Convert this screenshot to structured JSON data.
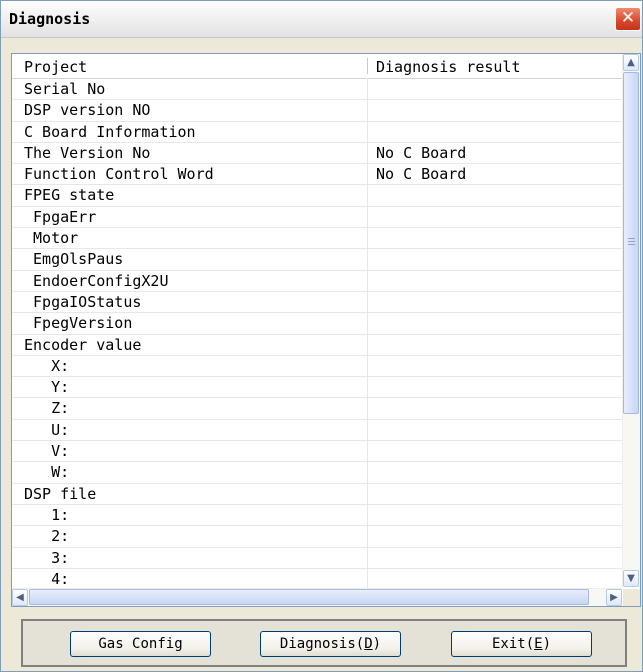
{
  "window": {
    "title": "Diagnosis",
    "close_symbol": "✕"
  },
  "table": {
    "columns": [
      "Project",
      "Diagnosis result"
    ],
    "rows": [
      {
        "project": "Serial No",
        "result": ""
      },
      {
        "project": "DSP version NO",
        "result": ""
      },
      {
        "project": "C Board Information",
        "result": ""
      },
      {
        "project": "The Version No",
        "result": "No C Board"
      },
      {
        "project": "Function Control Word",
        "result": "No C Board"
      },
      {
        "project": "FPEG state",
        "result": ""
      },
      {
        "project": " FpgaErr",
        "result": ""
      },
      {
        "project": " Motor",
        "result": ""
      },
      {
        "project": " EmgOlsPaus",
        "result": ""
      },
      {
        "project": " EndoerConfigX2U",
        "result": ""
      },
      {
        "project": " FpgaIOStatus",
        "result": ""
      },
      {
        "project": " FpegVersion",
        "result": ""
      },
      {
        "project": "Encoder value",
        "result": ""
      },
      {
        "project": "   X:",
        "result": ""
      },
      {
        "project": "   Y:",
        "result": ""
      },
      {
        "project": "   Z:",
        "result": ""
      },
      {
        "project": "   U:",
        "result": ""
      },
      {
        "project": "   V:",
        "result": ""
      },
      {
        "project": "   W:",
        "result": ""
      },
      {
        "project": "DSP file",
        "result": ""
      },
      {
        "project": "   1:",
        "result": ""
      },
      {
        "project": "   2:",
        "result": ""
      },
      {
        "project": "   3:",
        "result": ""
      },
      {
        "project": "   4:",
        "result": ""
      }
    ]
  },
  "scrollbars": {
    "up": "▲",
    "down": "▼",
    "left": "◀",
    "right": "▶"
  },
  "buttons": {
    "gas_config": "Gas Config",
    "diagnosis_prefix": "Diagnosis(",
    "diagnosis_key": "D",
    "diagnosis_suffix": ")",
    "exit_prefix": "Exit(",
    "exit_key": "E",
    "exit_suffix": ")"
  }
}
